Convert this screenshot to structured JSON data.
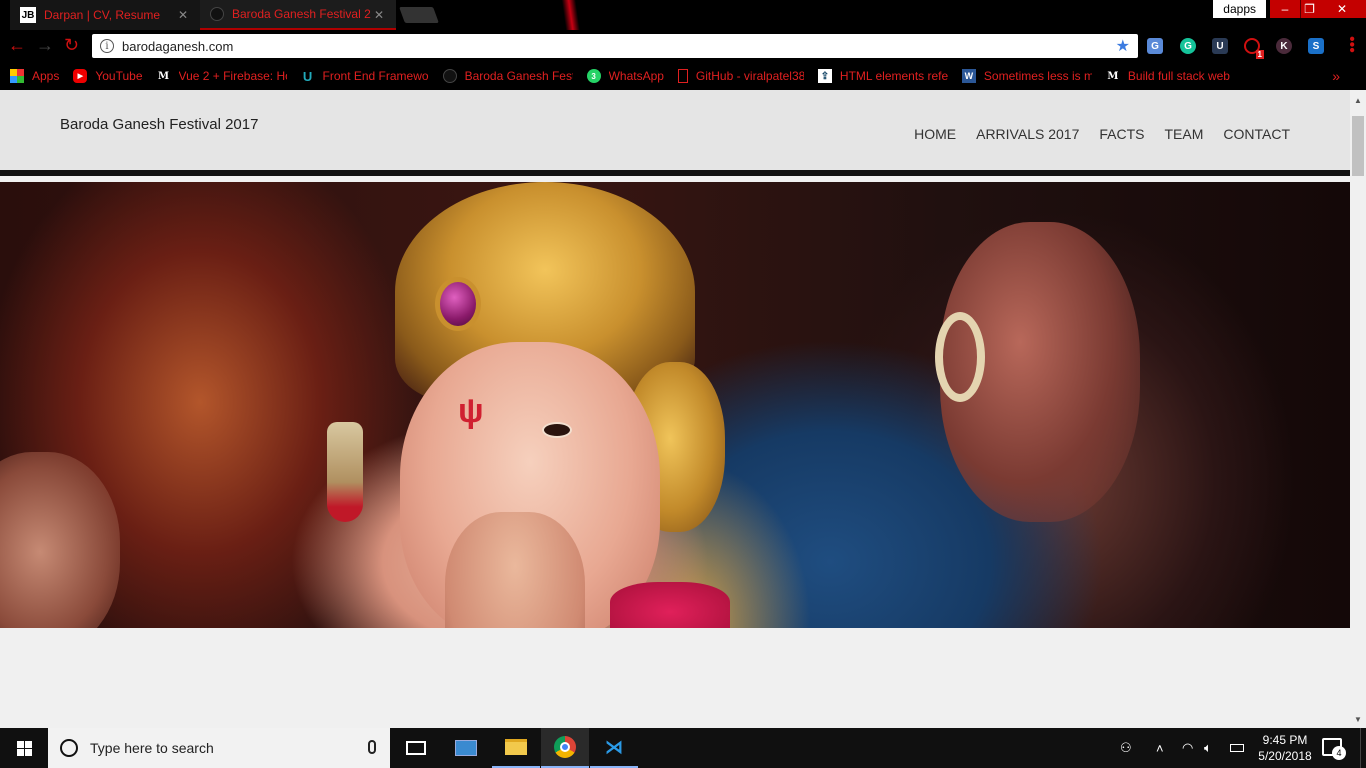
{
  "browser": {
    "tabs": [
      {
        "title": "Darpan | CV, Resume",
        "favicon": "JB"
      },
      {
        "title": "Baroda Ganesh Festival 2",
        "favicon": "dark-circle-icon"
      }
    ],
    "profile": "dapps",
    "url": "barodaganesh.com",
    "bookmarks": [
      {
        "label": "Apps",
        "icon": "apps-grid-icon"
      },
      {
        "label": "YouTube",
        "icon": "youtube-icon"
      },
      {
        "label": "Vue 2 + Firebase: Ho",
        "icon": "medium-icon"
      },
      {
        "label": "Front End Framewo",
        "icon": "udacity-icon"
      },
      {
        "label": "Baroda Ganesh Festi",
        "icon": "dark-circle-icon"
      },
      {
        "label": "WhatsApp",
        "icon": "whatsapp-icon"
      },
      {
        "label": "GitHub - viralpatel38",
        "icon": "bookmark-page-icon"
      },
      {
        "label": "HTML elements refe",
        "icon": "mdn-icon"
      },
      {
        "label": "Sometimes less is m",
        "icon": "word-icon"
      },
      {
        "label": "Build full stack web",
        "icon": "medium-icon"
      }
    ],
    "more_bookmarks": "»",
    "extension_badge": "1"
  },
  "site": {
    "title": "Baroda Ganesh Festival 2017",
    "nav": [
      "HOME",
      "ARRIVALS 2017",
      "FACTS",
      "TEAM",
      "CONTACT"
    ]
  },
  "taskbar": {
    "search_placeholder": "Type here to search",
    "time": "9:45 PM",
    "date": "5/20/2018",
    "notifications": "4"
  },
  "colors": {
    "accent_red": "#e02020",
    "chrome_bg": "#000000",
    "header_bg": "#e5e5e5",
    "page_bg": "#f0f0f0",
    "taskbar_bg": "#101010"
  }
}
